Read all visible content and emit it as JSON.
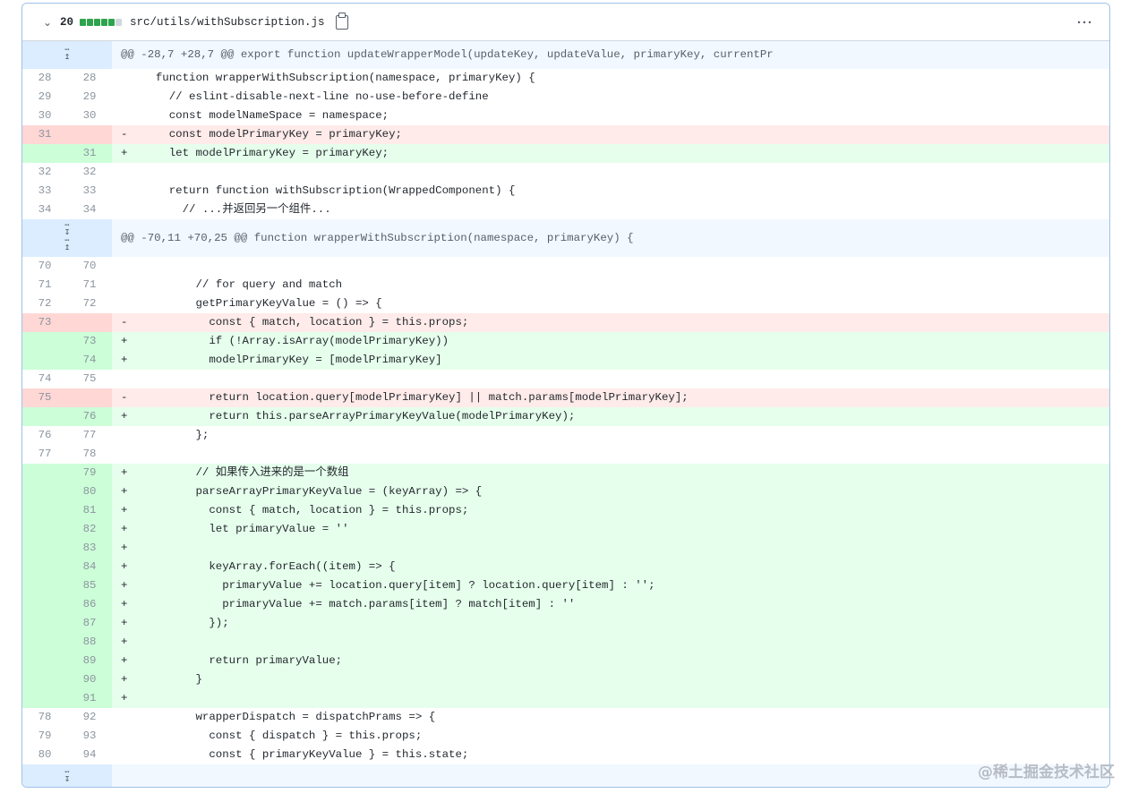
{
  "file": {
    "change_count": "20",
    "path": "src/utils/withSubscription.js",
    "diffstat": [
      "add",
      "add",
      "add",
      "add",
      "add",
      "neutral"
    ]
  },
  "hunks": [
    {
      "header": "@@ -28,7 +28,7 @@ export function updateWrapperModel(updateKey, updateValue, primaryKey, currentPr"
    },
    {
      "header": "@@ -70,11 +70,25 @@ function wrapperWithSubscription(namespace, primaryKey) {"
    }
  ],
  "lines1": [
    {
      "t": "ctx",
      "o": "28",
      "n": "28",
      "text": "  function wrapperWithSubscription(namespace, primaryKey) {"
    },
    {
      "t": "ctx",
      "o": "29",
      "n": "29",
      "text": "    // eslint-disable-next-line no-use-before-define"
    },
    {
      "t": "ctx",
      "o": "30",
      "n": "30",
      "text": "    const modelNameSpace = namespace;"
    },
    {
      "t": "del",
      "o": "31",
      "n": "",
      "text": "    const modelPrimaryKey = primaryKey;"
    },
    {
      "t": "add",
      "o": "",
      "n": "31",
      "text": "    let modelPrimaryKey = primaryKey;"
    },
    {
      "t": "ctx",
      "o": "32",
      "n": "32",
      "text": ""
    },
    {
      "t": "ctx",
      "o": "33",
      "n": "33",
      "text": "    return function withSubscription(WrappedComponent) {"
    },
    {
      "t": "ctx",
      "o": "34",
      "n": "34",
      "text": "      // ...并返回另一个组件..."
    }
  ],
  "lines2": [
    {
      "t": "ctx",
      "o": "70",
      "n": "70",
      "text": ""
    },
    {
      "t": "ctx",
      "o": "71",
      "n": "71",
      "text": "        // for query and match"
    },
    {
      "t": "ctx",
      "o": "72",
      "n": "72",
      "text": "        getPrimaryKeyValue = () => {"
    },
    {
      "t": "del",
      "o": "73",
      "n": "",
      "text": "          const { match, location } = this.props;"
    },
    {
      "t": "add",
      "o": "",
      "n": "73",
      "text": "          if (!Array.isArray(modelPrimaryKey))"
    },
    {
      "t": "add",
      "o": "",
      "n": "74",
      "text": "          modelPrimaryKey = [modelPrimaryKey]"
    },
    {
      "t": "ctx",
      "o": "74",
      "n": "75",
      "text": ""
    },
    {
      "t": "del",
      "o": "75",
      "n": "",
      "text": "          return location.query[modelPrimaryKey] || match.params[modelPrimaryKey];"
    },
    {
      "t": "add",
      "o": "",
      "n": "76",
      "text": "          return this.parseArrayPrimaryKeyValue(modelPrimaryKey);"
    },
    {
      "t": "ctx",
      "o": "76",
      "n": "77",
      "text": "        };"
    },
    {
      "t": "ctx",
      "o": "77",
      "n": "78",
      "text": ""
    },
    {
      "t": "add",
      "o": "",
      "n": "79",
      "text": "        // 如果传入进来的是一个数组"
    },
    {
      "t": "add",
      "o": "",
      "n": "80",
      "text": "        parseArrayPrimaryKeyValue = (keyArray) => {"
    },
    {
      "t": "add",
      "o": "",
      "n": "81",
      "text": "          const { match, location } = this.props;"
    },
    {
      "t": "add",
      "o": "",
      "n": "82",
      "text": "          let primaryValue = ''"
    },
    {
      "t": "add",
      "o": "",
      "n": "83",
      "text": ""
    },
    {
      "t": "add",
      "o": "",
      "n": "84",
      "text": "          keyArray.forEach((item) => {"
    },
    {
      "t": "add",
      "o": "",
      "n": "85",
      "text": "            primaryValue += location.query[item] ? location.query[item] : '';"
    },
    {
      "t": "add",
      "o": "",
      "n": "86",
      "text": "            primaryValue += match.params[item] ? match[item] : ''"
    },
    {
      "t": "add",
      "o": "",
      "n": "87",
      "text": "          });"
    },
    {
      "t": "add",
      "o": "",
      "n": "88",
      "text": ""
    },
    {
      "t": "add",
      "o": "",
      "n": "89",
      "text": "          return primaryValue;"
    },
    {
      "t": "add",
      "o": "",
      "n": "90",
      "text": "        }"
    },
    {
      "t": "add",
      "o": "",
      "n": "91",
      "text": ""
    },
    {
      "t": "ctx",
      "o": "78",
      "n": "92",
      "text": "        wrapperDispatch = dispatchPrams => {"
    },
    {
      "t": "ctx",
      "o": "79",
      "n": "93",
      "text": "          const { dispatch } = this.props;"
    },
    {
      "t": "ctx",
      "o": "80",
      "n": "94",
      "text": "          const { primaryKeyValue } = this.state;"
    }
  ],
  "markers": {
    "add": "+",
    "del": "-"
  },
  "watermark": "@稀土掘金技术社区",
  "colors": {
    "add_bg": "#e6ffec",
    "del_bg": "#ffebe9",
    "hunk_bg": "#f1f8ff",
    "accent": "#2da44e"
  }
}
